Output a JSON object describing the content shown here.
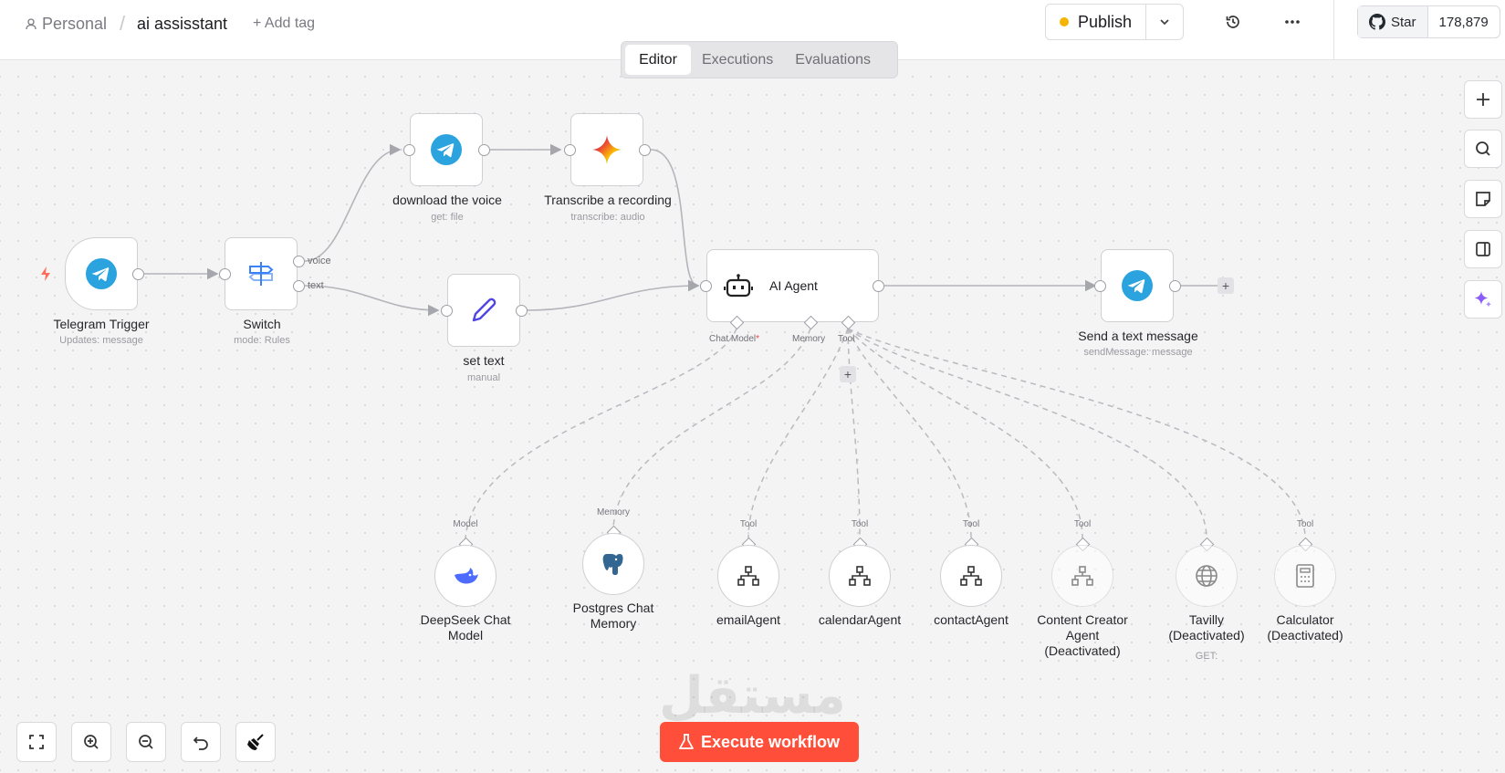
{
  "header": {
    "workspace": "Personal",
    "workflow_name": "ai assisstant",
    "add_tag": "+ Add tag",
    "publish": "Publish",
    "github_star": "Star",
    "github_count": "178,879"
  },
  "tabs": [
    "Editor",
    "Executions",
    "Evaluations"
  ],
  "nodes": {
    "telegram_trigger": {
      "label": "Telegram Trigger",
      "sub": "Updates: message"
    },
    "switch": {
      "label": "Switch",
      "sub": "mode: Rules",
      "out1": "voice",
      "out2": "text"
    },
    "download_voice": {
      "label": "download the voice",
      "sub": "get: file"
    },
    "transcribe": {
      "label": "Transcribe a recording",
      "sub": "transcribe: audio"
    },
    "set_text": {
      "label": "set text",
      "sub": "manual"
    },
    "ai_agent": {
      "label": "AI Agent",
      "port_model": "Chat Model",
      "port_model_req": "*",
      "port_memory": "Memory",
      "port_tool": "Tool"
    },
    "send_message": {
      "label": "Send a text message",
      "sub": "sendMessage: message"
    },
    "deepseek": {
      "cap": "Model",
      "label1": "DeepSeek Chat",
      "label2": "Model"
    },
    "postgres": {
      "cap": "Memory",
      "label1": "Postgres Chat",
      "label2": "Memory"
    },
    "email_agent": {
      "cap": "Tool",
      "label": "emailAgent"
    },
    "calendar_agent": {
      "cap": "Tool",
      "label": "calendarAgent"
    },
    "contact_agent": {
      "cap": "Tool",
      "label": "contactAgent"
    },
    "content_creator": {
      "cap": "Tool",
      "label1": "Content Creator",
      "label2": "Agent",
      "label3": "(Deactivated)"
    },
    "tavilly": {
      "label1": "Tavilly",
      "label2": "(Deactivated)",
      "sub": "GET:"
    },
    "calculator": {
      "cap": "Tool",
      "label1": "Calculator",
      "label2": "(Deactivated)"
    }
  },
  "footer": {
    "execute": "Execute workflow",
    "watermark": "مستقل"
  },
  "colors": {
    "accent": "#ff4f3a",
    "telegram": "#2aa3de",
    "publish_dot": "#f5b400"
  }
}
